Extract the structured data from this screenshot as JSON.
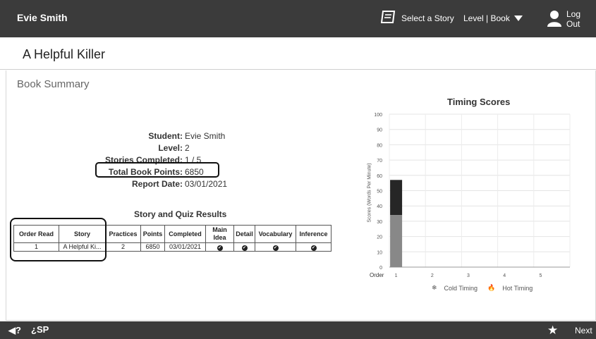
{
  "header": {
    "user_name": "Evie Smith",
    "select_story_label": "Select a Story",
    "level_book_label": "Level | Book",
    "logout_label": "Log Out"
  },
  "page_title": "A Helpful Killer",
  "section_title": "Book Summary",
  "summary": {
    "student_label": "Student:",
    "student_value": "Evie Smith",
    "level_label": "Level:",
    "level_value": "2",
    "stories_label": "Stories Completed:",
    "stories_value": "1 / 5",
    "points_label": "Total Book Points:",
    "points_value": "6850",
    "date_label": "Report Date:",
    "date_value": "03/01/2021"
  },
  "results": {
    "title": "Story and Quiz Results",
    "headers": [
      "Order Read",
      "Story",
      "Practices",
      "Points",
      "Completed",
      "Main Idea",
      "Detail",
      "Vocabulary",
      "Inference"
    ],
    "rows": [
      {
        "order": "1",
        "story": "A Helpful Ki...",
        "practices": "2",
        "points": "6850",
        "completed": "03/01/2021",
        "main_idea": "✔",
        "detail": "✔",
        "vocabulary": "✔",
        "inference": "✔"
      }
    ]
  },
  "chart_data": {
    "type": "bar",
    "title": "Timing Scores",
    "ylabel": "Scores (Words Per Minute)",
    "xlabel": "Order",
    "categories": [
      "1",
      "2",
      "3",
      "4",
      "5"
    ],
    "ylim": [
      0,
      100
    ],
    "yticks": [
      0,
      10,
      20,
      30,
      40,
      50,
      60,
      70,
      80,
      90,
      100
    ],
    "series": [
      {
        "name": "Cold Timing",
        "values": [
          34,
          null,
          null,
          null,
          null
        ],
        "color": "#888888"
      },
      {
        "name": "Hot Timing",
        "values": [
          57,
          null,
          null,
          null,
          null
        ],
        "color": "#262626"
      }
    ],
    "grid": true,
    "legend_position": "bottom"
  },
  "footer": {
    "audio_label": "◀?",
    "sp_label": "¿SP",
    "next_label": "Next"
  },
  "colors": {
    "bar_bg": "#3b3b3b",
    "cold": "#888888",
    "hot": "#262626"
  }
}
